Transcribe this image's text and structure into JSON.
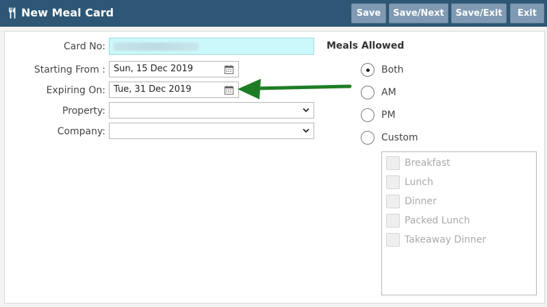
{
  "header": {
    "title": "New Meal Card",
    "icon": "fork-knife-icon",
    "bg_color": "#2e5775",
    "buttons": {
      "save": "Save",
      "save_next": "Save/Next",
      "save_exit": "Save/Exit",
      "exit": "Exit"
    }
  },
  "form": {
    "card_no": {
      "label": "Card No:",
      "value": ""
    },
    "starting_from": {
      "label": "Starting From :",
      "value": "Sun, 15 Dec 2019",
      "icon": "calendar-icon"
    },
    "expiring_on": {
      "label": "Expiring On:",
      "value": "Tue, 31 Dec 2019",
      "icon": "calendar-icon"
    },
    "property": {
      "label": "Property:",
      "value": ""
    },
    "company": {
      "label": "Company:",
      "value": ""
    }
  },
  "meals_allowed": {
    "title": "Meals Allowed",
    "options": [
      {
        "label": "Both",
        "selected": true
      },
      {
        "label": "AM",
        "selected": false
      },
      {
        "label": "PM",
        "selected": false
      },
      {
        "label": "Custom",
        "selected": false
      }
    ],
    "custom_meals": [
      {
        "label": "Breakfast",
        "checked": false,
        "disabled": true
      },
      {
        "label": "Lunch",
        "checked": false,
        "disabled": true
      },
      {
        "label": "Dinner",
        "checked": false,
        "disabled": true
      },
      {
        "label": "Packed Lunch",
        "checked": false,
        "disabled": true
      },
      {
        "label": "Takeaway Dinner",
        "checked": false,
        "disabled": true
      }
    ]
  },
  "annotation": {
    "arrow_color": "#1e7d24"
  }
}
